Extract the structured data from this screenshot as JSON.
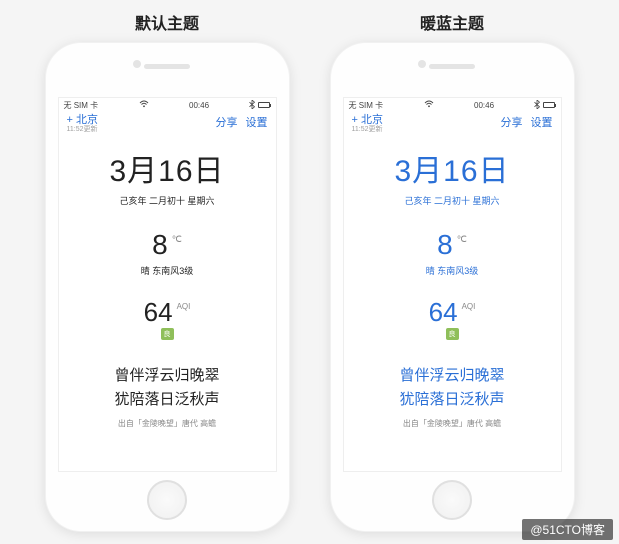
{
  "themes": {
    "default": {
      "title": "默认主题"
    },
    "blue": {
      "title": "暖蓝主题"
    }
  },
  "statusbar": {
    "carrier": "无 SIM 卡",
    "wifi_icon": "wifi",
    "time": "00:46",
    "bt_icon": "bluetooth",
    "battery_icon": "battery"
  },
  "appbar": {
    "location_prefix": "+",
    "location": "北京",
    "update_sub": "11:52更新",
    "share": "分享",
    "settings": "设置"
  },
  "content": {
    "date": "3月16日",
    "lunar": "己亥年 二月初十 星期六",
    "temperature": "8",
    "temp_unit": "℃",
    "weather": "晴 东南风3级",
    "aqi": "64",
    "aqi_label": "AQI",
    "aqi_badge": "良",
    "poem_line1": "曾伴浮云归晚翠",
    "poem_line2": "犹陪落日泛秋声",
    "poem_source": "出自「金陵晚望」唐代 高蟾"
  },
  "watermark": "@51CTO博客"
}
